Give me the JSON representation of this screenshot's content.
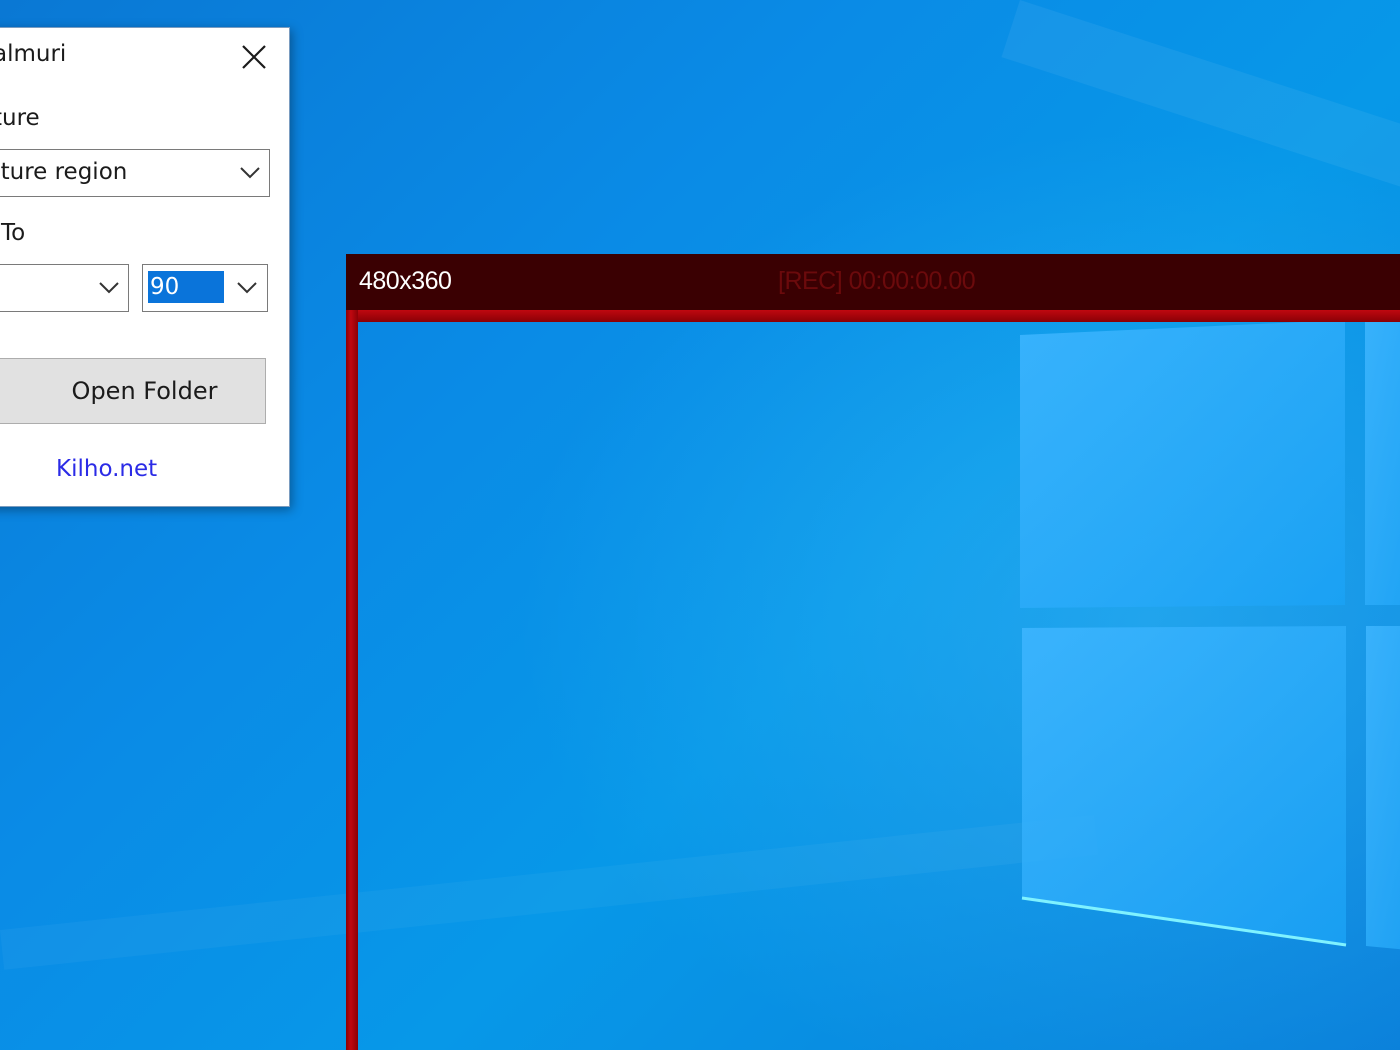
{
  "desktop": {
    "background": "#0a86e0",
    "logo": "windows-logo"
  },
  "dialog": {
    "title": "almuri",
    "close_icon": "close-icon",
    "capture_label": "ture",
    "capture_mode_value": "pture region",
    "to_label": "To",
    "from_value": "",
    "to_value": "90",
    "open_folder_label": "Open Folder",
    "link_label": "Kilho.net",
    "link_color": "#2b2be6",
    "selection_color": "#0a74da"
  },
  "recorder": {
    "size_label": "480x360",
    "rec_label": "[REC] 00:00:00.00",
    "bar_color": "#3a0002",
    "border_color": "#c00810"
  }
}
